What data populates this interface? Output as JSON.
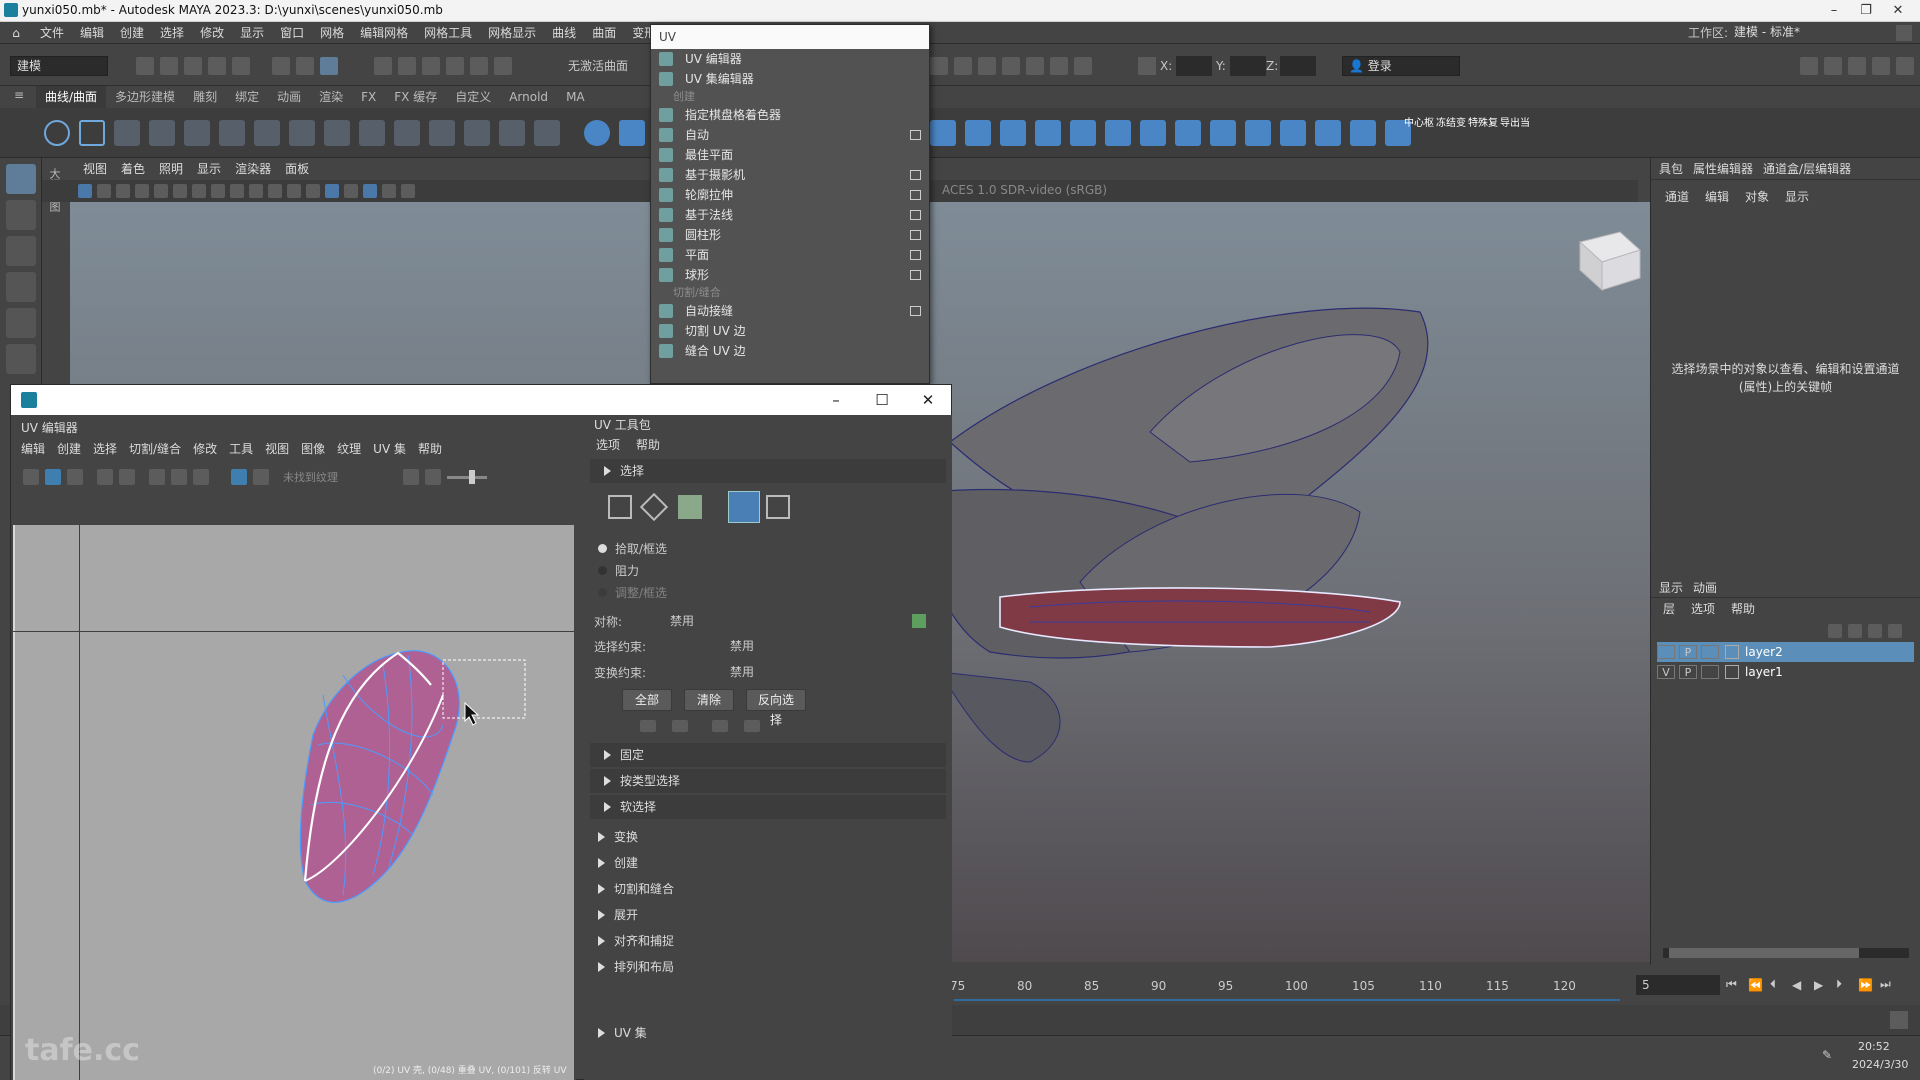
{
  "titlebar": {
    "title": "yunxi050.mb* - Autodesk MAYA 2023.3: D:\\yunxi\\scenes\\yunxi050.mb"
  },
  "menubar": {
    "items": [
      "文件",
      "编辑",
      "创建",
      "选择",
      "修改",
      "显示",
      "窗口",
      "网格",
      "编辑网格",
      "网格工具",
      "网格显示",
      "曲线",
      "曲面",
      "变形"
    ],
    "workspace_label": "工作区:",
    "workspace_value": "建模 - 标准*"
  },
  "statusline": {
    "mode": "建模",
    "live_surface": "无激活曲面",
    "x_label": "X:",
    "y_label": "Y:",
    "z_label": "Z:",
    "login": "登录"
  },
  "shelf": {
    "tabs": [
      "曲线/曲面",
      "多边形建模",
      "雕刻",
      "绑定",
      "动画",
      "渲染",
      "FX",
      "FX 缓存",
      "自定义",
      "Arnold",
      "MA"
    ],
    "right_labels": [
      "中心枢",
      "冻结变",
      "特殊复",
      "导出当"
    ]
  },
  "viewport": {
    "menu": [
      "视图",
      "着色",
      "照明",
      "显示",
      "渲染器",
      "面板"
    ],
    "colorspace": "ACES 1.0 SDR-video (sRGB)",
    "side_label": "大纲视图"
  },
  "channelbox": {
    "tabs": [
      "具包",
      "属性编辑器",
      "通道盒/层编辑器"
    ],
    "menu": [
      "通道",
      "编辑",
      "对象",
      "显示"
    ],
    "hint": "选择场景中的对象以查看、编辑和设置通道(属性)上的关键帧"
  },
  "layers": {
    "tabs": [
      "显示",
      "动画"
    ],
    "menu": [
      "层",
      "选项",
      "帮助"
    ],
    "rows": [
      {
        "v": "",
        "p": "P",
        "name": "layer2",
        "selected": true
      },
      {
        "v": "V",
        "p": "P",
        "name": "layer1",
        "selected": false
      }
    ]
  },
  "timeline": {
    "ticks": [
      "75",
      "80",
      "85",
      "90",
      "95",
      "100",
      "105",
      "110",
      "115",
      "120"
    ],
    "current_frame": "5"
  },
  "clock": {
    "time": "20:52",
    "date": "2024/3/30"
  },
  "uvmenu": {
    "header": "UV",
    "items": [
      {
        "label": "UV 编辑器",
        "box": false
      },
      {
        "label": "UV 集编辑器",
        "box": false
      }
    ],
    "sec_create": "创建",
    "create_items": [
      {
        "label": "指定棋盘格着色器",
        "box": false
      },
      {
        "label": "自动",
        "box": true
      },
      {
        "label": "最佳平面",
        "box": false
      },
      {
        "label": "基于摄影机",
        "box": true
      },
      {
        "label": "轮廓拉伸",
        "box": true
      },
      {
        "label": "基于法线",
        "box": true
      },
      {
        "label": "圆柱形",
        "box": true
      },
      {
        "label": "平面",
        "box": true
      },
      {
        "label": "球形",
        "box": true
      }
    ],
    "sec_cut": "切割/缝合",
    "cut_items": [
      {
        "label": "自动接缝",
        "box": true
      },
      {
        "label": "切割 UV 边",
        "box": false
      },
      {
        "label": "缝合 UV 边",
        "box": false
      }
    ]
  },
  "uveditor": {
    "title": "UV 编辑器",
    "menu": [
      "编辑",
      "创建",
      "选择",
      "切割/缝合",
      "修改",
      "工具",
      "视图",
      "图像",
      "纹理",
      "UV 集",
      "帮助"
    ],
    "texture_placeholder": "未找到纹理",
    "status": "(0/2) UV 壳, (0/48) 重叠 UV, (0/101) 反转 UV"
  },
  "toolkit": {
    "title": "UV 工具包",
    "menu": [
      "选项",
      "帮助"
    ],
    "select_section": "选择",
    "radios": [
      "拾取/框选",
      "阻力",
      "调整/框选"
    ],
    "symmetry_label": "对称:",
    "symmetry_value": "禁用",
    "sel_constraint_label": "选择约束:",
    "sel_constraint_value": "禁用",
    "xform_constraint_label": "变换约束:",
    "xform_constraint_value": "禁用",
    "buttons": [
      "全部",
      "清除",
      "反向选择"
    ],
    "subsections": [
      "固定",
      "按类型选择",
      "软选择"
    ],
    "sections": [
      "变换",
      "创建",
      "切割和缝合",
      "展开",
      "对齐和捕捉",
      "排列和布局"
    ],
    "uvset_section": "UV 集"
  },
  "watermark": "tafe.cc",
  "colors": {
    "accent": "#5b8fb9",
    "selection": "#4a7fb5",
    "uvshell": "#b05590",
    "uvedge": "#4c9bff"
  }
}
